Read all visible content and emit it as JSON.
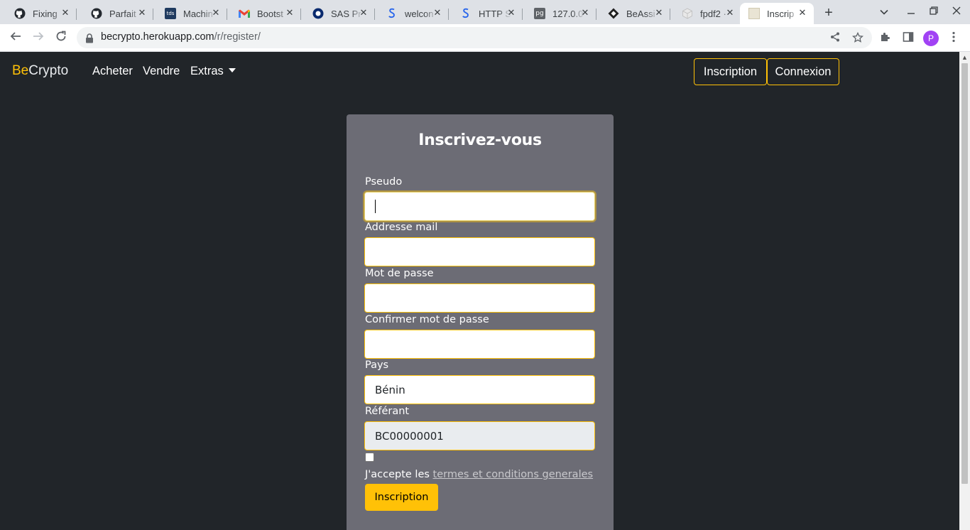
{
  "browser": {
    "tabs": [
      {
        "title": "Fixing",
        "icon": "github-icon",
        "active": false
      },
      {
        "title": "Parfait",
        "icon": "github-icon",
        "active": false
      },
      {
        "title": "Machin",
        "icon": "tds-icon",
        "icon_text": "tds",
        "active": false
      },
      {
        "title": "Bootst",
        "icon": "gmail-icon",
        "active": false
      },
      {
        "title": "SAS Pr",
        "icon": "sas-icon",
        "active": false
      },
      {
        "title": "welcon",
        "icon": "stripe-icon",
        "active": false
      },
      {
        "title": "HTTP S",
        "icon": "stripe-icon",
        "active": false
      },
      {
        "title": "127.0.0",
        "icon": "pgadmin-icon",
        "icon_text": "pg",
        "active": false
      },
      {
        "title": "BeAssi",
        "icon": "diamond-icon",
        "active": false
      },
      {
        "title": "fpdf2 ·",
        "icon": "package-icon",
        "active": false
      },
      {
        "title": "Inscrip",
        "icon": "becrypto-icon",
        "active": true
      }
    ],
    "url_host": "becrypto.herokuapp.com",
    "url_path": "/r/register/",
    "profile_initial": "P"
  },
  "site": {
    "brand_prefix": "Be",
    "brand_suffix": "Crypto",
    "nav": {
      "buy": "Acheter",
      "sell": "Vendre",
      "extras": "Extras"
    },
    "auth": {
      "register": "Inscription",
      "login": "Connexion"
    }
  },
  "form": {
    "title": "Inscrivez-vous",
    "fields": {
      "username": {
        "label": "Pseudo",
        "value": ""
      },
      "email": {
        "label": "Addresse mail",
        "value": ""
      },
      "password": {
        "label": "Mot de passe",
        "value": ""
      },
      "confirm": {
        "label": "Confirmer mot de passe",
        "value": ""
      },
      "country": {
        "label": "Pays",
        "value": "Bénin"
      },
      "referrer": {
        "label": "Référant",
        "value": "BC00000001"
      }
    },
    "terms_prefix": "J'accepte les",
    "terms_link": "termes et conditions generales",
    "submit": "Inscription"
  },
  "colors": {
    "accent": "#ffc107",
    "page_bg": "#212529",
    "card_bg": "#6c6c75"
  }
}
